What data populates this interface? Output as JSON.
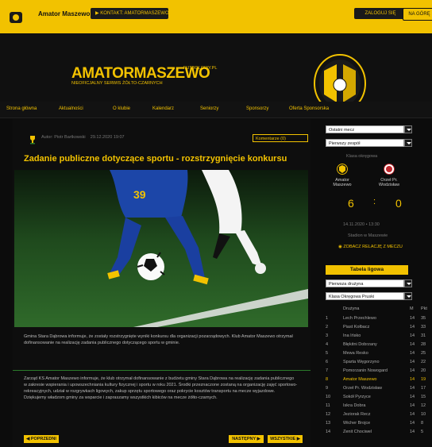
{
  "topbar": {
    "site_label": "Amator Maszewo",
    "contact_label": "▶ KONTAKT: AMATORMASZEWO",
    "user_label": "ZALOGUJ SIĘ",
    "panel_label": "NA GÓRĘ"
  },
  "header": {
    "brand": "AMATORMASZEWO",
    "brand_tail": "FUTBOLOWY.PL",
    "brand_sub": "NIEOFICJALNY SERWIS ŻÓŁTO-CZARNYCH",
    "crest_colors": [
      "#1a1a1a",
      "#f2c200"
    ]
  },
  "nav": {
    "items": [
      "Strona główna",
      "Aktualności",
      "O klubie",
      "Kalendarz",
      "Seniorzy",
      "Sponsorzy",
      "Oferta Sponsorska"
    ]
  },
  "article": {
    "meta_author": "Autor: Piotr Bartkowski",
    "meta_date": "29.12.2020 19:07",
    "meta_right": "Komentarze (0)",
    "title": "Zadanie publiczne dotyczące sportu - rozstrzygnięcie konkursu",
    "photo_number": "39",
    "intro": "Gmina Stara Dąbrowa informuje, że zostały rozstrzygnięte wyniki konkursu dla organizacji pozarządowych. Klub Amator Maszewo otrzymał dofinansowanie na realizację zadania publicznego dotyczącego sportu w gminie.",
    "body": "Zarząd KS Amator Maszewo informuje, że klub otrzymał dofinansowanie z budżetu gminy Stara Dąbrowa na realizację zadania publicznego w zakresie wspierania i upowszechniania kultury fizycznej i sportu w roku 2021. Środki przeznaczone zostaną na organizację zajęć sportowo-rekreacyjnych, udział w rozgrywkach ligowych, zakup sprzętu sportowego oraz pokrycie kosztów transportu na mecze wyjazdowe. Dziękujemy władzom gminy za wsparcie i zapraszamy wszystkich kibiców na mecze żółto-czarnych.",
    "prev_label": "◀ POPRZEDNI",
    "next_label": "NASTĘPNY ▶",
    "all_label": "WSZYSTKIE ▶"
  },
  "sidebar": {
    "select1": "Ostatni mecz",
    "select2": "Pierwszy zespół",
    "match_label": "Klasa okręgowa",
    "home_team": "Amator Maszewo",
    "away_team": "Orzeł Pr. Wodzisław",
    "home_score": "6",
    "away_score": "0",
    "separator": ":",
    "date_line": "14.11.2020 • 13:30",
    "venue_line": "Stadion w Maszewie",
    "report_line": "◉ ZOBACZ RELACJĘ Z MECZU",
    "table_title": "Tabela ligowa",
    "select3": "Pierwsza drużyna",
    "select4": "Klasa Okręgowa Pruski",
    "table_header": "Drużyna",
    "table_header_m": "M",
    "table_header_p": "Pkt",
    "rows": [
      {
        "pos": "1",
        "name": "Lech Przechlewo",
        "m": "14",
        "p": "35"
      },
      {
        "pos": "2",
        "name": "Piast Kołbacz",
        "m": "14",
        "p": "33"
      },
      {
        "pos": "3",
        "name": "Ina Ińsko",
        "m": "14",
        "p": "31"
      },
      {
        "pos": "4",
        "name": "Błękitni Dobrzany",
        "m": "14",
        "p": "28"
      },
      {
        "pos": "5",
        "name": "Mewa Resko",
        "m": "14",
        "p": "25"
      },
      {
        "pos": "6",
        "name": "Sparta Węgorzyno",
        "m": "14",
        "p": "22"
      },
      {
        "pos": "7",
        "name": "Pomorzanin Nowogard",
        "m": "14",
        "p": "20"
      },
      {
        "pos": "8",
        "name": "Amator Maszewo",
        "m": "14",
        "p": "19"
      },
      {
        "pos": "9",
        "name": "Orzeł Pr. Wodzisław",
        "m": "14",
        "p": "17"
      },
      {
        "pos": "10",
        "name": "Sokół Pyrzyce",
        "m": "14",
        "p": "15"
      },
      {
        "pos": "11",
        "name": "Iskra Dobra",
        "m": "14",
        "p": "12"
      },
      {
        "pos": "12",
        "name": "Jeziorak Recz",
        "m": "14",
        "p": "10"
      },
      {
        "pos": "13",
        "name": "Wicher Brojce",
        "m": "14",
        "p": "8"
      },
      {
        "pos": "14",
        "name": "Zenit Chociwel",
        "m": "14",
        "p": "5"
      }
    ]
  }
}
